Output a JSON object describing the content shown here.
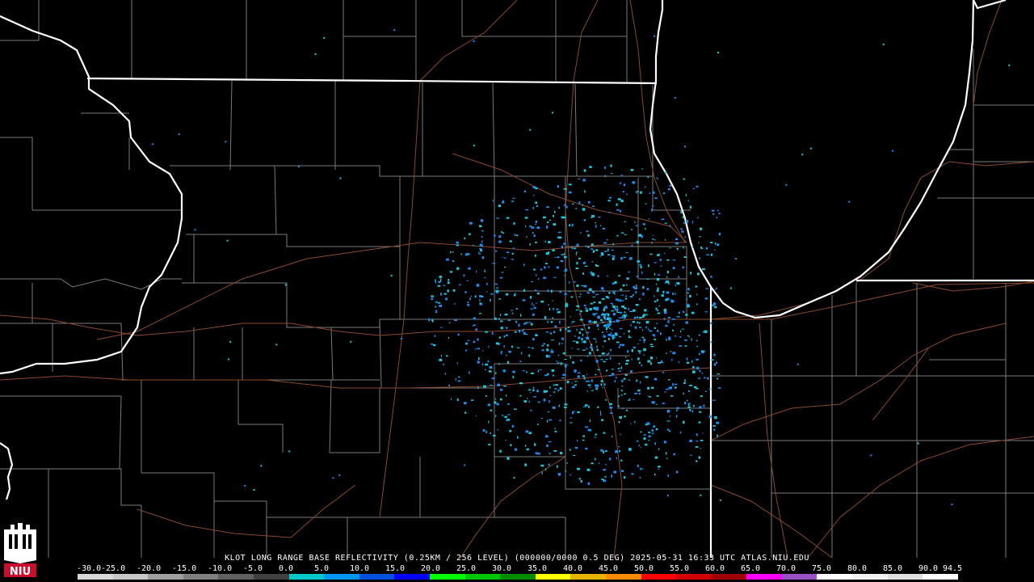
{
  "caption": "KLOT LONG RANGE BASE REFLECTIVITY (0.25KM / 256 LEVEL) (000000/0000 0.5 DEG) 2025-05-31 16:33 UTC  ATLAS.NIU.EDU",
  "logo": {
    "text": "NIU",
    "color": "#c8102e"
  },
  "scale": {
    "labels": [
      "-30.0",
      "-25.0",
      "-20.0",
      "-15.0",
      "-10.0",
      "-5.0",
      "0.0",
      "5.0",
      "10.0",
      "15.0",
      "20.0",
      "25.0",
      "30.0",
      "35.0",
      "40.0",
      "45.0",
      "50.0",
      "55.0",
      "60.0",
      "65.0",
      "70.0",
      "75.0",
      "80.0",
      "85.0",
      "90.0",
      "94.5"
    ],
    "colors": [
      "#d8d8d8",
      "#c8c8c8",
      "#a0a0a0",
      "#808080",
      "#606060",
      "#404040",
      "#06c8c8",
      "#0096f0",
      "#0050e0",
      "#0000ff",
      "#00ff00",
      "#00c800",
      "#008c00",
      "#ffff00",
      "#e6b400",
      "#ff8c00",
      "#ff0000",
      "#d40000",
      "#a00000",
      "#ff00ff",
      "#9c50c8",
      "#ffffff",
      "#f0f0f0",
      "#e0e0e0",
      "#ffffff"
    ]
  },
  "colors": {
    "background": "#000000",
    "state_border": "#ffffff",
    "county_line": "#7a7a7a",
    "road": "#8a4a2a",
    "echo_light": "#1ec8dc",
    "echo_mid": "#1e8cf0"
  },
  "map": {
    "radar_site": "KLOT",
    "echo_values_dbz": [
      0,
      5,
      10
    ]
  }
}
